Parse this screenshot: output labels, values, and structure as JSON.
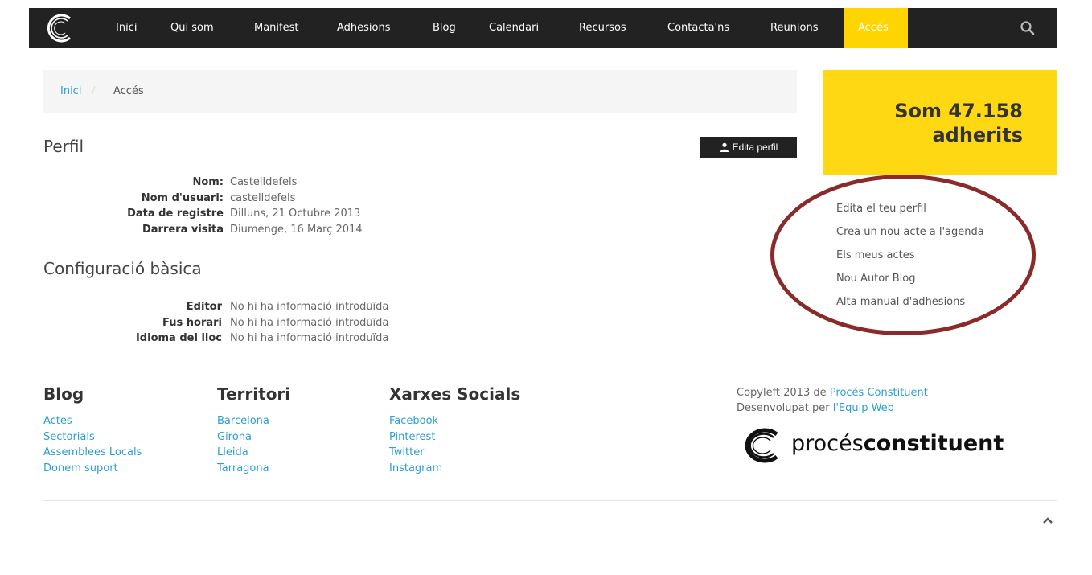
{
  "nav": {
    "items": [
      "Inici",
      "Qui som",
      "Manifest",
      "Adhesions",
      "Blog",
      "Calendari",
      "Recursos",
      "Contacta'ns",
      "Reunions"
    ],
    "active": "Accés"
  },
  "breadcrumb": {
    "home": "Inici",
    "separator": "/",
    "current": "Accés"
  },
  "profile": {
    "title": "Perfil",
    "edit_label": "Edita perfil",
    "fields": [
      {
        "label": "Nom:",
        "value": "Castelldefels"
      },
      {
        "label": "Nom d'usuari:",
        "value": "castelldefels"
      },
      {
        "label": "Data de registre",
        "value": "Dilluns, 21 Octubre 2013"
      },
      {
        "label": "Darrera visita",
        "value": "Diumenge, 16 Març 2014"
      }
    ]
  },
  "config": {
    "title": "Configuració bàsica",
    "fields": [
      {
        "label": "Editor",
        "value": "No hi ha informació introduïda"
      },
      {
        "label": "Fus horari",
        "value": "No hi ha informació introduïda"
      },
      {
        "label": "Idioma del lloc",
        "value": "No hi ha informació introduïda"
      }
    ]
  },
  "counter": {
    "line1": "Som 47.158",
    "line2": "adherits"
  },
  "side_links": [
    "Edita el teu perfil",
    "Crea un nou acte a l'agenda",
    "Els meus actes",
    "Nou Autor Blog",
    "Alta manual d'adhesions"
  ],
  "footer": {
    "blog": {
      "title": "Blog",
      "links": [
        "Actes",
        "Sectorials",
        "Assemblees Locals",
        "Donem suport"
      ]
    },
    "territori": {
      "title": "Territori",
      "links": [
        "Barcelona",
        "Girona",
        "Lleida",
        "Tarragona"
      ]
    },
    "xarxes": {
      "title": "Xarxes Socials",
      "links": [
        "Facebook",
        "Pinterest",
        "Twitter",
        "Instagram"
      ]
    },
    "copyleft_prefix": "Copyleft 2013 de",
    "copyleft_link": "Procés Constituent",
    "developed_prefix": "Desenvolupat per",
    "developed_link": "l'Equip Web",
    "brand_light": "procés",
    "brand_bold": "constituent"
  },
  "colors": {
    "accent": "#ffd500",
    "nav_bg": "#222222",
    "link": "#2a9fd6",
    "ring": "#8b2a2a"
  },
  "icons": {
    "logo": "c-swirl-logo-icon",
    "search": "search-icon",
    "user": "user-icon",
    "scroll_top": "chevron-up-icon"
  }
}
